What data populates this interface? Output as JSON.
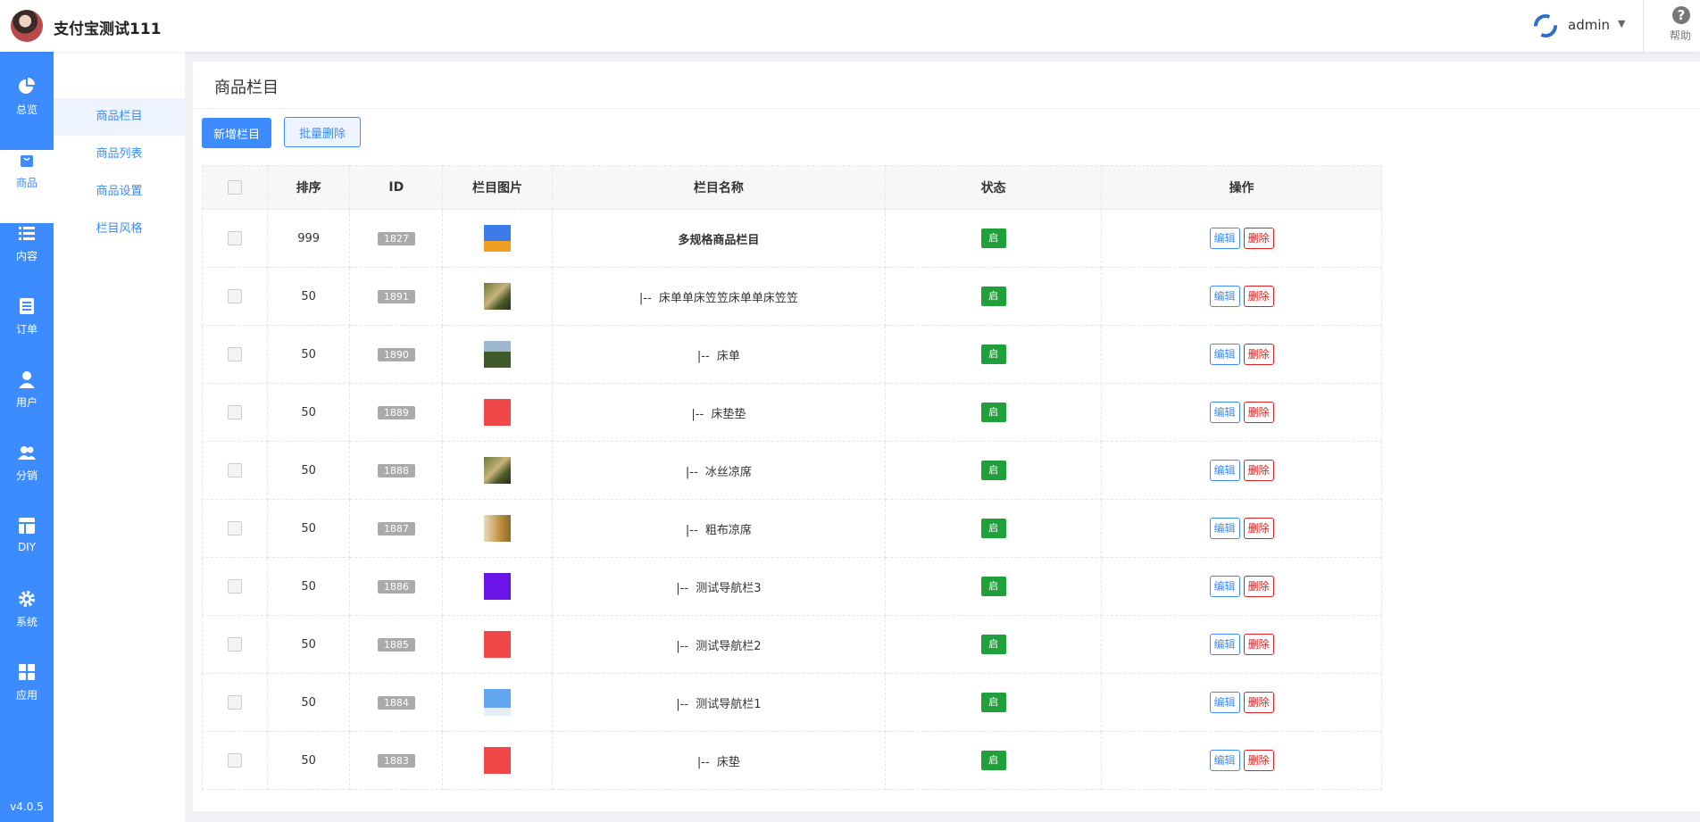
{
  "header": {
    "shop_name": "支付宝测试111",
    "user_name": "admin",
    "help_label": "帮助"
  },
  "rail": {
    "items": [
      {
        "label": "总览",
        "icon": "pie-chart-icon"
      },
      {
        "label": "商品",
        "icon": "shopping-bag-icon"
      },
      {
        "label": "内容",
        "icon": "list-icon"
      },
      {
        "label": "订单",
        "icon": "document-icon"
      },
      {
        "label": "用户",
        "icon": "user-icon"
      },
      {
        "label": "分销",
        "icon": "users-icon"
      },
      {
        "label": "DIY",
        "icon": "layout-icon"
      },
      {
        "label": "系统",
        "icon": "gear-icon"
      },
      {
        "label": "应用",
        "icon": "grid-icon"
      }
    ],
    "active": "商品",
    "version": "v4.0.5"
  },
  "subnav": {
    "items": [
      {
        "label": "商品栏目"
      },
      {
        "label": "商品列表"
      },
      {
        "label": "商品设置"
      },
      {
        "label": "栏目风格"
      }
    ],
    "active": "商品栏目"
  },
  "page": {
    "title": "商品栏目",
    "add_button": "新增栏目",
    "batch_delete_button": "批量删除"
  },
  "table": {
    "headers": [
      "排序",
      "ID",
      "栏目图片",
      "栏目名称",
      "状态",
      "操作"
    ],
    "edit_label": "编辑",
    "delete_label": "删除",
    "rows": [
      {
        "sort": "999",
        "id": "1827",
        "name": "多规格商品栏目",
        "status": "启",
        "thumb": "promo"
      },
      {
        "sort": "50",
        "id": "1891",
        "name": "|--  床单单床笠笠床单单床笠笠",
        "status": "启",
        "thumb": "photo"
      },
      {
        "sort": "50",
        "id": "1890",
        "name": "|--  床单",
        "status": "启",
        "thumb": "landscape"
      },
      {
        "sort": "50",
        "id": "1889",
        "name": "|--  床垫垫",
        "status": "启",
        "thumb": "red"
      },
      {
        "sort": "50",
        "id": "1888",
        "name": "|--  冰丝凉席",
        "status": "启",
        "thumb": "photo"
      },
      {
        "sort": "50",
        "id": "1887",
        "name": "|--  粗布凉席",
        "status": "启",
        "thumb": "gold"
      },
      {
        "sort": "50",
        "id": "1886",
        "name": "|--  测试导航栏3",
        "status": "启",
        "thumb": "purple"
      },
      {
        "sort": "50",
        "id": "1885",
        "name": "|--  测试导航栏2",
        "status": "启",
        "thumb": "red"
      },
      {
        "sort": "50",
        "id": "1884",
        "name": "|--  测试导航栏1",
        "status": "启",
        "thumb": "screen"
      },
      {
        "sort": "50",
        "id": "1883",
        "name": "|--  床垫",
        "status": "启",
        "thumb": "red"
      }
    ]
  },
  "colors": {
    "primary": "#3c8bff",
    "success": "#1fa03a",
    "danger": "#e02020"
  }
}
